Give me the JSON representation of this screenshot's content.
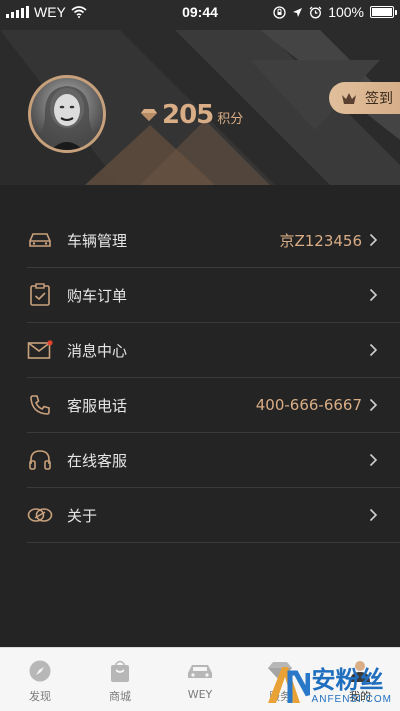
{
  "status": {
    "carrier": "WEY",
    "time": "09:44",
    "battery": "100%"
  },
  "profile": {
    "points": "205",
    "points_unit": "积分",
    "sign_in": "签到"
  },
  "menu": [
    {
      "label": "车辆管理",
      "value": "京Z123456"
    },
    {
      "label": "购车订单",
      "value": ""
    },
    {
      "label": "消息中心",
      "value": ""
    },
    {
      "label": "客服电话",
      "value": "400-666-6667"
    },
    {
      "label": "在线客服",
      "value": ""
    },
    {
      "label": "关于",
      "value": ""
    }
  ],
  "tabs": [
    {
      "label": "发现",
      "icon": "compass-icon"
    },
    {
      "label": "商城",
      "icon": "shopping-bag-icon"
    },
    {
      "label": "WEY",
      "icon": "car-icon"
    },
    {
      "label": "服务",
      "icon": "diamond-icon"
    },
    {
      "label": "我的",
      "icon": "person-icon"
    }
  ],
  "watermark": {
    "text": "安粉丝",
    "sub": "ANFENSI.COM"
  },
  "colors": {
    "accent": "#d9ad85",
    "background": "#242424",
    "tabbar": "#f6f6f6"
  }
}
